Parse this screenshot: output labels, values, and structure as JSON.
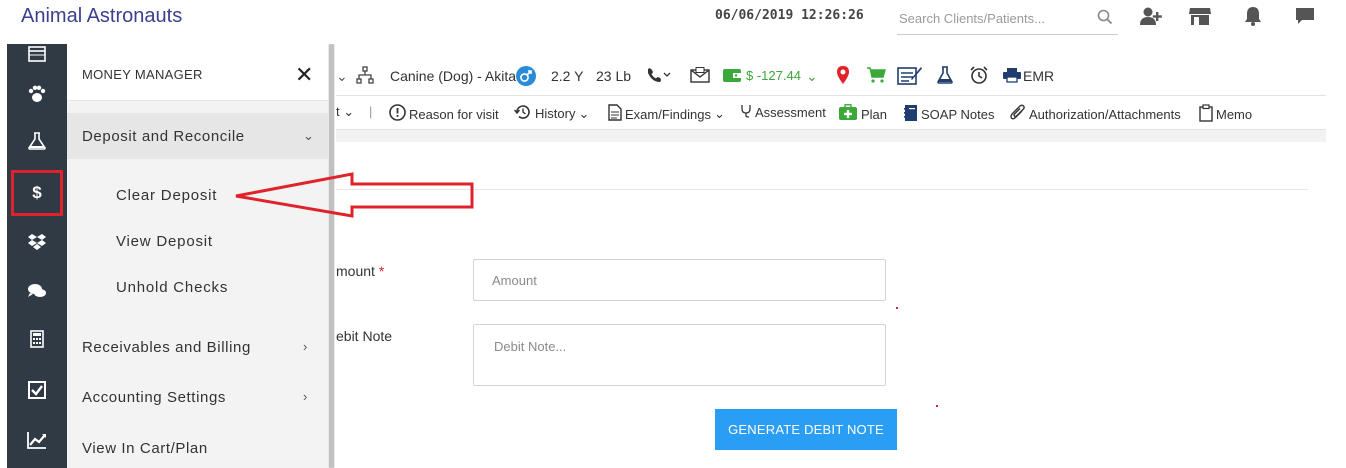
{
  "app": {
    "title": "Animal Astronauts",
    "datetime": "06/06/2019 12:26:26"
  },
  "search": {
    "placeholder": "Search Clients/Patients..."
  },
  "top_icons": [
    "add-user-icon",
    "store-icon",
    "bell-icon",
    "chat-icon"
  ],
  "rail": {
    "items": [
      "calendar-icon",
      "paw-icon",
      "flask-icon",
      "dollar-icon",
      "dropbox-icon",
      "comments-icon",
      "calculator-icon",
      "checkbox-icon",
      "chart-icon"
    ],
    "highlighted": "dollar-icon",
    "highlight_color": "#e0232a"
  },
  "drawer": {
    "title": "MONEY MANAGER",
    "sections": [
      {
        "label": "Deposit and Reconcile",
        "expanded": true,
        "items": [
          "Clear Deposit",
          "View Deposit",
          "Unhold Checks"
        ]
      },
      {
        "label": "Receivables and Billing",
        "expanded": false
      },
      {
        "label": "Accounting Settings",
        "expanded": false
      },
      {
        "label": "View In Cart/Plan",
        "expanded": false
      }
    ]
  },
  "patient_bar": {
    "species": "Canine (Dog) - Akita",
    "age": "2.2 Y",
    "weight": "23 Lb",
    "balance": "$ -127.44",
    "emr": "EMR",
    "balance_color": "#3aa93a"
  },
  "visit_bar": {
    "reason": "Reason for visit",
    "history": "History",
    "exam": "Exam/Findings",
    "assessment": "Assessment",
    "plan": "Plan",
    "soap": "SOAP Notes",
    "auth": "Authorization/Attachments",
    "memo": "Memo"
  },
  "form": {
    "amount_label": "mount",
    "amount_required": "*",
    "amount_placeholder": "Amount",
    "debit_label": "ebit Note",
    "debit_placeholder": "Debit Note...",
    "generate_button": "GENERATE DEBIT NOTE",
    "button_color": "#2a9df4"
  }
}
